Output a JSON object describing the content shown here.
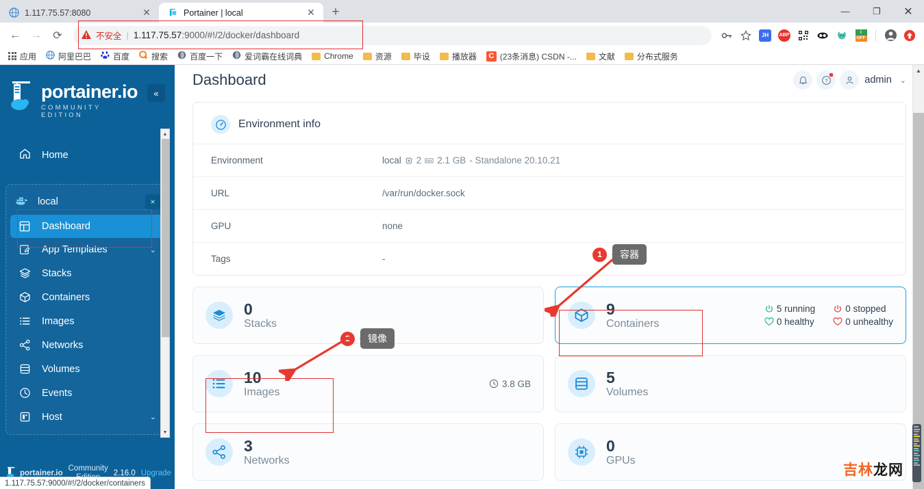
{
  "browser": {
    "tabs": [
      {
        "title": "1.117.75.57:8080",
        "favicon": "globe-icon",
        "active": false
      },
      {
        "title": "Portainer | local",
        "favicon": "portainer-icon",
        "active": true
      }
    ],
    "new_tab_label": "+",
    "window_controls": {
      "minimize": "—",
      "maximize": "❐",
      "close": "✕"
    },
    "nav": {
      "back": "←",
      "forward": "→",
      "reload": "⟳"
    },
    "omnibox": {
      "security_label": "不安全",
      "url_host": "1.117.75.57",
      "url_rest": ":9000/#!/2/docker/dashboard",
      "full_url": "1.117.75.57:9000/#!/2/docker/dashboard"
    },
    "toolbar_icons": [
      "key-icon",
      "star-icon",
      "jh-extension-icon",
      "abp-extension-icon",
      "qr-extension-icon",
      "eyes-extension-icon",
      "cat-extension-icon",
      "off-extension-icon",
      "profile-icon",
      "update-icon"
    ],
    "extension_labels": {
      "jh": "JH",
      "abp": "ABP",
      "off": "OFF"
    },
    "bookmarks": [
      {
        "label": "应用",
        "icon": "apps-grid-icon"
      },
      {
        "label": "阿里巴巴",
        "icon": "globe-icon"
      },
      {
        "label": "百度",
        "icon": "baidu-icon"
      },
      {
        "label": "搜索",
        "icon": "search-o-icon"
      },
      {
        "label": "百度一下",
        "icon": "globe-icon"
      },
      {
        "label": "爱词霸在线词典",
        "icon": "globe-icon"
      },
      {
        "label": "Chrome",
        "icon": "folder-icon"
      },
      {
        "label": "资源",
        "icon": "folder-icon"
      },
      {
        "label": "毕设",
        "icon": "folder-icon"
      },
      {
        "label": "播放器",
        "icon": "folder-icon"
      },
      {
        "label": "(23条消息) CSDN -...",
        "icon": "csdn-icon"
      },
      {
        "label": "文献",
        "icon": "folder-icon"
      },
      {
        "label": "分布式服务",
        "icon": "folder-icon"
      }
    ]
  },
  "sidebar": {
    "logo_name": "portainer.io",
    "logo_subtitle": "COMMUNITY EDITION",
    "collapse_label": "«",
    "home": {
      "label": "Home",
      "icon": "home-icon"
    },
    "environment": {
      "label": "local",
      "icon": "docker-icon",
      "close_label": "×"
    },
    "items": [
      {
        "label": "Dashboard",
        "icon": "dashboard-icon",
        "active": true,
        "chevron": ""
      },
      {
        "label": "App Templates",
        "icon": "template-icon",
        "active": false,
        "chevron": "⌄"
      },
      {
        "label": "Stacks",
        "icon": "stacks-icon",
        "active": false,
        "chevron": ""
      },
      {
        "label": "Containers",
        "icon": "container-icon",
        "active": false,
        "chevron": ""
      },
      {
        "label": "Images",
        "icon": "images-icon",
        "active": false,
        "chevron": ""
      },
      {
        "label": "Networks",
        "icon": "networks-icon",
        "active": false,
        "chevron": ""
      },
      {
        "label": "Volumes",
        "icon": "volumes-icon",
        "active": false,
        "chevron": ""
      },
      {
        "label": "Events",
        "icon": "events-icon",
        "active": false,
        "chevron": ""
      },
      {
        "label": "Host",
        "icon": "host-icon",
        "active": false,
        "chevron": "⌄"
      }
    ],
    "footer": {
      "brand": "portainer.io",
      "edition_line1": "Community",
      "edition_line2": "Edition",
      "version": "2.16.0",
      "upgrade": "Upgrade"
    }
  },
  "header": {
    "title": "Dashboard",
    "bell_icon": "bell-icon",
    "help_icon": "help-icon",
    "user_icon": "user-icon",
    "user": "admin",
    "chevron": "⌄"
  },
  "environment_info": {
    "title": "Environment info",
    "icon": "gauge-icon",
    "rows": [
      {
        "key": "Environment",
        "value": "local",
        "cpu": "2",
        "mem": "2.1 GB",
        "suffix": "- Standalone 20.10.21"
      },
      {
        "key": "URL",
        "value": "/var/run/docker.sock"
      },
      {
        "key": "GPU",
        "value": "none"
      },
      {
        "key": "Tags",
        "value": "-"
      }
    ]
  },
  "tiles": {
    "stacks": {
      "count": "0",
      "label": "Stacks",
      "icon": "stacks-icon"
    },
    "images": {
      "count": "10",
      "label": "Images",
      "icon": "images-icon",
      "size": "3.8 GB",
      "size_icon": "clock-icon"
    },
    "networks": {
      "count": "3",
      "label": "Networks",
      "icon": "networks-icon"
    },
    "containers": {
      "count": "9",
      "label": "Containers",
      "icon": "container-icon",
      "stats": [
        {
          "text": "5 running",
          "icon": "power-icon",
          "color": "#2bb597"
        },
        {
          "text": "0 stopped",
          "icon": "power-icon",
          "color": "#e0463c"
        },
        {
          "text": "0 healthy",
          "icon": "heart-icon",
          "color": "#2bb597"
        },
        {
          "text": "0 unhealthy",
          "icon": "heart-icon",
          "color": "#e0463c"
        }
      ]
    },
    "volumes": {
      "count": "5",
      "label": "Volumes",
      "icon": "volumes-icon"
    },
    "gpus": {
      "count": "0",
      "label": "GPUs",
      "icon": "gpu-icon"
    }
  },
  "annotations": [
    {
      "number": "1",
      "tooltip": "容器",
      "target": "containers-tile"
    },
    {
      "number": "2",
      "tooltip": "镜像",
      "target": "images-tile"
    }
  ],
  "watermark": {
    "part1": "吉林",
    "part2": "龙网"
  },
  "statusbar": {
    "text": "1.117.75.57:9000/#!/2/docker/containers"
  },
  "colors": {
    "sidebar_bg": "#0c6199",
    "active_nav": "#1a91d6",
    "accent": "#18a0e8",
    "annotation_red": "#e03131",
    "badge_red": "#e8392f",
    "warn_red": "#d93025",
    "green": "#2bb597",
    "watermark_orange": "#f26522"
  }
}
